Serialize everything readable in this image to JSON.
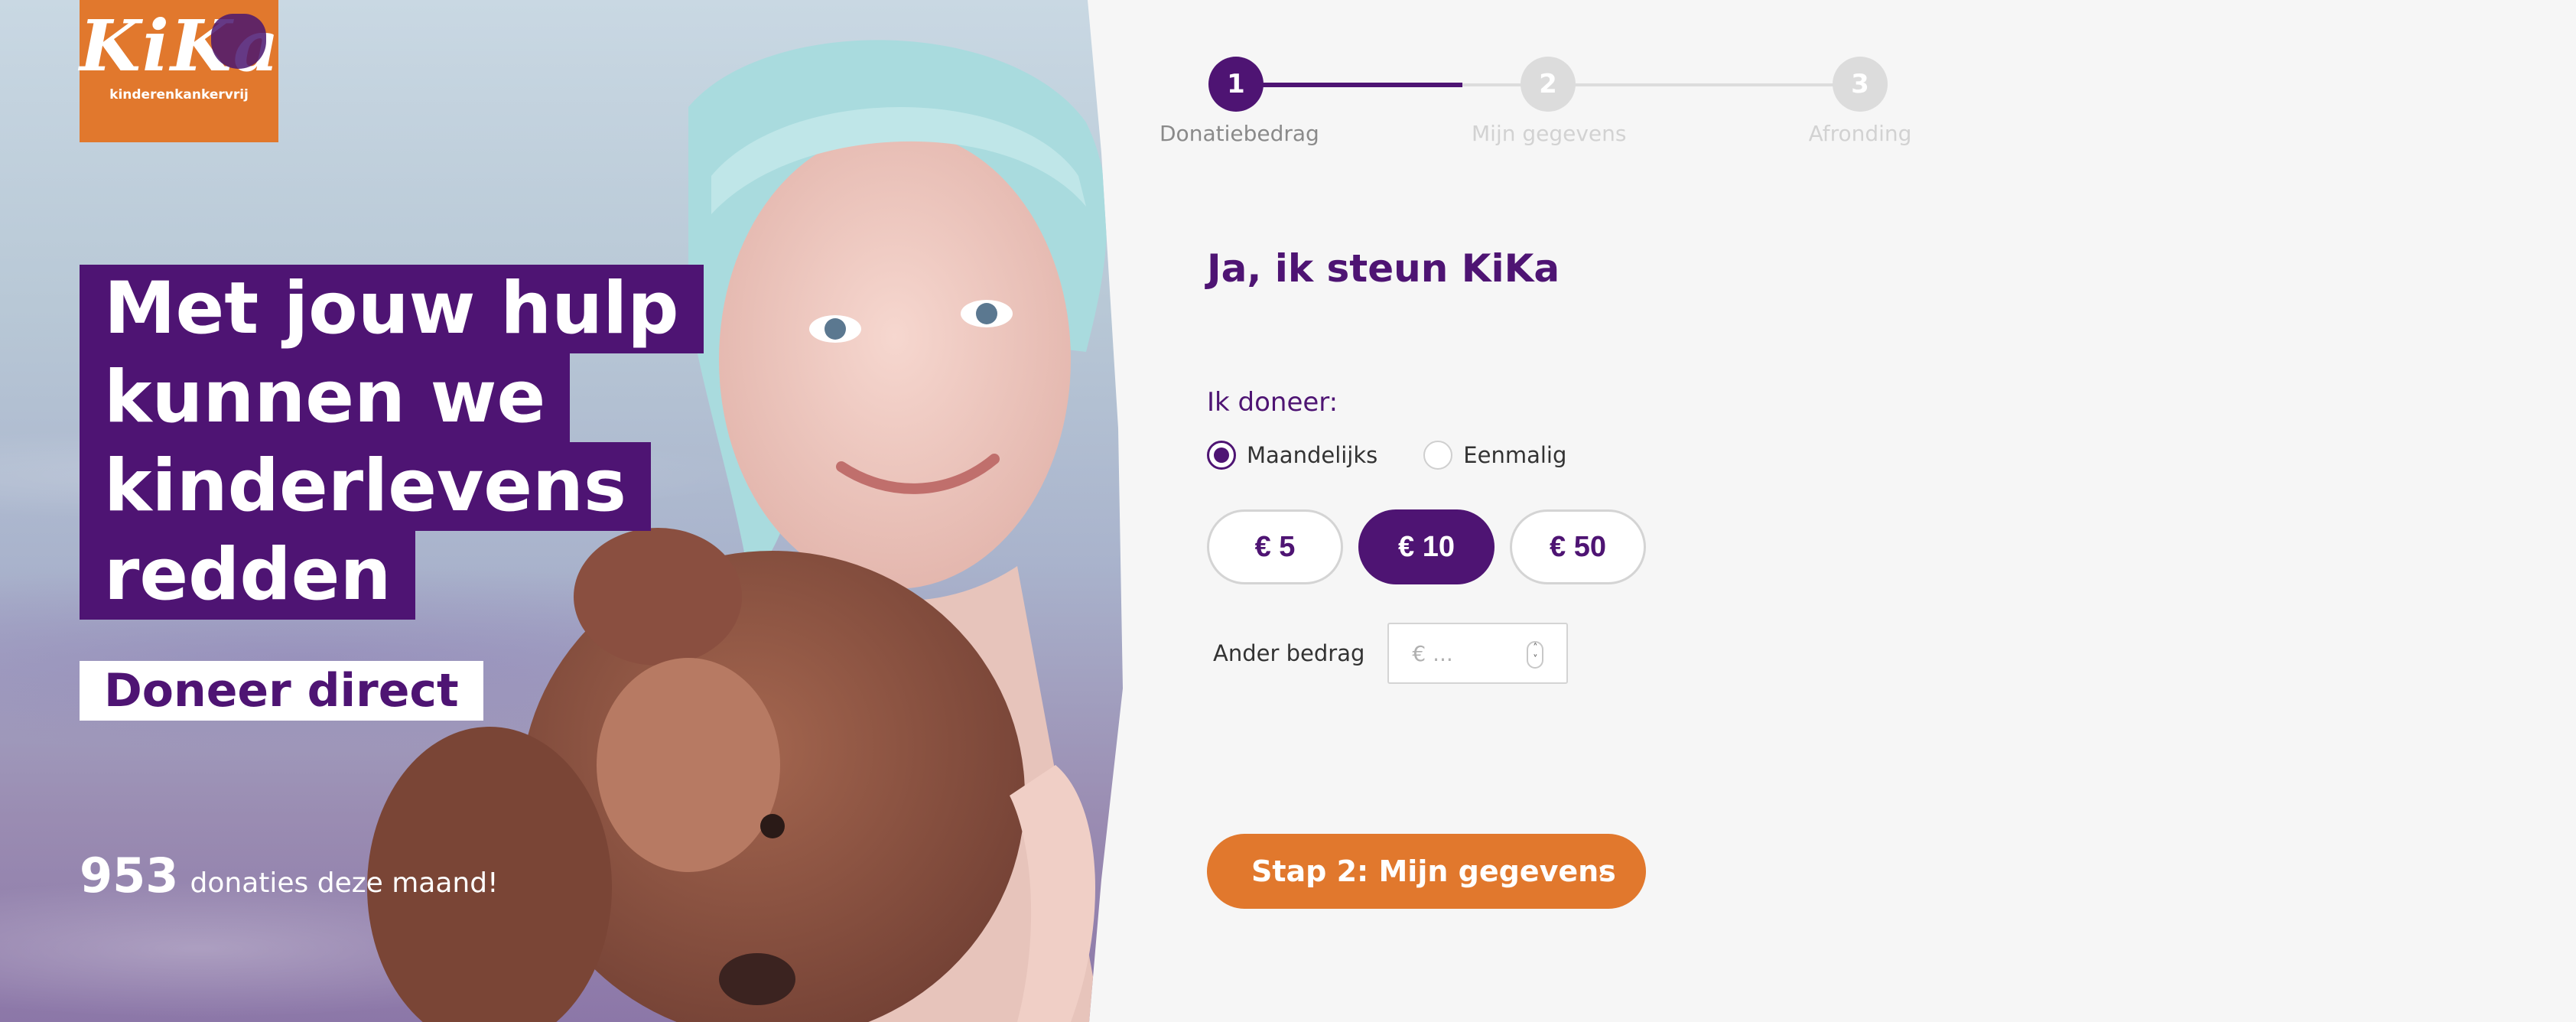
{
  "logo": {
    "mark": "KiKa",
    "tagline": "kinderenkankervrij"
  },
  "hero": {
    "headline_lines": [
      "Met jouw hulp",
      "kunnen we",
      "kinderlevens",
      "redden"
    ],
    "cta": "Doneer direct",
    "donation_count": "953",
    "donation_count_text": "donaties deze maand!"
  },
  "stepper": {
    "current_step": 1,
    "steps": [
      {
        "number": "1",
        "label": "Donatiebedrag"
      },
      {
        "number": "2",
        "label": "Mijn gegevens"
      },
      {
        "number": "3",
        "label": "Afronding"
      }
    ]
  },
  "form": {
    "title": "Ja, ik steun KiKa",
    "donate_label": "Ik doneer:",
    "frequency": {
      "selected": "Maandelijks",
      "options": [
        "Maandelijks",
        "Eenmalig"
      ]
    },
    "amounts": {
      "selected": "€ 10",
      "options": [
        "€ 5",
        "€ 10",
        "€ 50"
      ]
    },
    "other_amount": {
      "label": "Ander bedrag",
      "placeholder": "€ ...",
      "value": ""
    },
    "next_button": "Stap 2: Mijn gegevens",
    "next_icon": "chevron-right-icon"
  },
  "colors": {
    "brand_purple": "#4e1473",
    "brand_orange": "#e1782d",
    "background": "#f6f6f6",
    "inactive_gray": "#dcdcdc"
  }
}
